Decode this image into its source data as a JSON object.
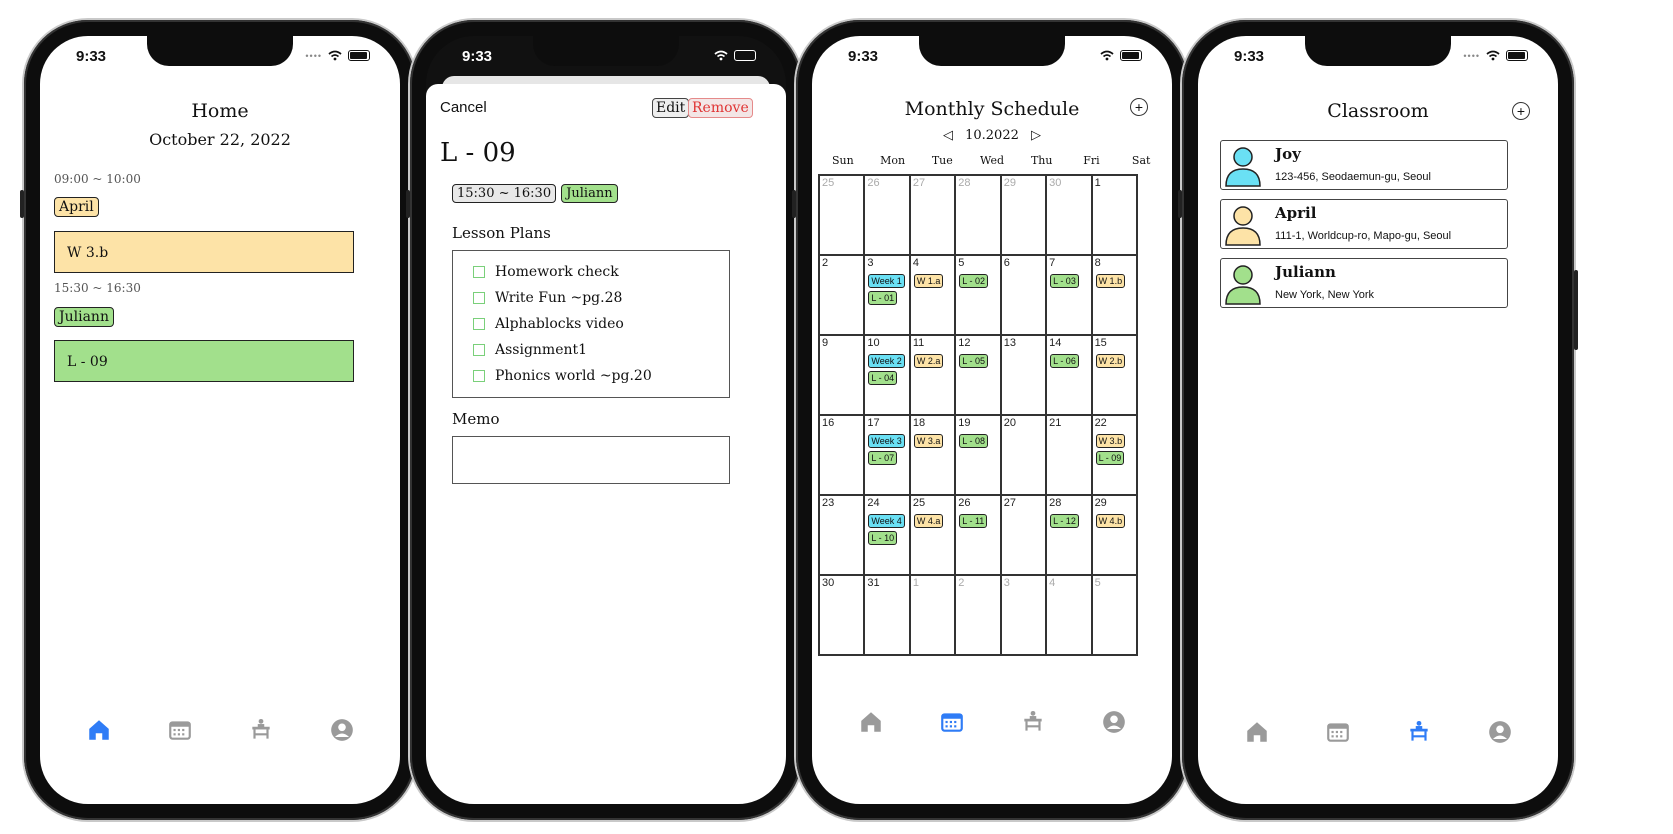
{
  "status": {
    "time": "9:33"
  },
  "colors": {
    "yellow": "#fde3a7",
    "green": "#a2e08c",
    "cyan": "#6ae0f4",
    "active_tab": "#2f7cf6",
    "inactive_tab": "#9a9a9a"
  },
  "tabs": [
    {
      "icon": "home-icon"
    },
    {
      "icon": "calendar-icon"
    },
    {
      "icon": "classroom-desk-icon"
    },
    {
      "icon": "profile-icon"
    }
  ],
  "home": {
    "title": "Home",
    "date": "October 22, 2022",
    "slots": [
      {
        "time": "09:00 ~ 10:00",
        "student": "April",
        "lesson": "W 3.b",
        "color": "yellow"
      },
      {
        "time": "15:30 ~ 16:30",
        "student": "Juliann",
        "lesson": "L - 09",
        "color": "green"
      }
    ]
  },
  "detail": {
    "cancel": "Cancel",
    "edit": "Edit",
    "remove": "Remove",
    "lesson_title": "L - 09",
    "time_tag": "15:30 ~ 16:30",
    "student_tag": "Juliann",
    "lesson_plans_label": "Lesson Plans",
    "plans": [
      "Homework check",
      "Write Fun ~pg.28",
      "Alphablocks video",
      "Assignment1",
      "Phonics world ~pg.20"
    ],
    "memo_label": "Memo",
    "memo_value": ""
  },
  "calendar": {
    "title": "Monthly Schedule",
    "month": "10.2022",
    "weekdays": [
      "Sun",
      "Mon",
      "Tue",
      "Wed",
      "Thu",
      "Fri",
      "Sat"
    ],
    "weeks": [
      [
        {
          "d": "25",
          "dim": true,
          "ev": []
        },
        {
          "d": "26",
          "dim": true,
          "ev": []
        },
        {
          "d": "27",
          "dim": true,
          "ev": []
        },
        {
          "d": "28",
          "dim": true,
          "ev": []
        },
        {
          "d": "29",
          "dim": true,
          "ev": []
        },
        {
          "d": "30",
          "dim": true,
          "ev": []
        },
        {
          "d": "1",
          "ev": []
        }
      ],
      [
        {
          "d": "2",
          "ev": []
        },
        {
          "d": "3",
          "ev": [
            {
              "t": "Week 1",
              "c": "cyan"
            },
            {
              "t": "L - 01",
              "c": "green"
            }
          ]
        },
        {
          "d": "4",
          "ev": [
            {
              "t": "W 1.a",
              "c": "yellow"
            }
          ]
        },
        {
          "d": "5",
          "ev": [
            {
              "t": "L - 02",
              "c": "green"
            }
          ]
        },
        {
          "d": "6",
          "ev": []
        },
        {
          "d": "7",
          "ev": [
            {
              "t": "L - 03",
              "c": "green"
            }
          ]
        },
        {
          "d": "8",
          "ev": [
            {
              "t": "W 1.b",
              "c": "yellow"
            }
          ]
        }
      ],
      [
        {
          "d": "9",
          "ev": []
        },
        {
          "d": "10",
          "ev": [
            {
              "t": "Week 2",
              "c": "cyan"
            },
            {
              "t": "L - 04",
              "c": "green"
            }
          ]
        },
        {
          "d": "11",
          "ev": [
            {
              "t": "W 2.a",
              "c": "yellow"
            }
          ]
        },
        {
          "d": "12",
          "ev": [
            {
              "t": "L - 05",
              "c": "green"
            }
          ]
        },
        {
          "d": "13",
          "ev": []
        },
        {
          "d": "14",
          "ev": [
            {
              "t": "L - 06",
              "c": "green"
            }
          ]
        },
        {
          "d": "15",
          "ev": [
            {
              "t": "W 2.b",
              "c": "yellow"
            }
          ]
        }
      ],
      [
        {
          "d": "16",
          "ev": []
        },
        {
          "d": "17",
          "ev": [
            {
              "t": "Week 3",
              "c": "cyan"
            },
            {
              "t": "L - 07",
              "c": "green"
            }
          ]
        },
        {
          "d": "18",
          "ev": [
            {
              "t": "W 3.a",
              "c": "yellow"
            }
          ]
        },
        {
          "d": "19",
          "ev": [
            {
              "t": "L - 08",
              "c": "green"
            }
          ]
        },
        {
          "d": "20",
          "ev": []
        },
        {
          "d": "21",
          "ev": []
        },
        {
          "d": "22",
          "ev": [
            {
              "t": "W 3.b",
              "c": "yellow"
            },
            {
              "t": "L - 09",
              "c": "green"
            }
          ]
        }
      ],
      [
        {
          "d": "23",
          "ev": []
        },
        {
          "d": "24",
          "ev": [
            {
              "t": "Week 4",
              "c": "cyan"
            },
            {
              "t": "L - 10",
              "c": "green"
            }
          ]
        },
        {
          "d": "25",
          "ev": [
            {
              "t": "W 4.a",
              "c": "yellow"
            }
          ]
        },
        {
          "d": "26",
          "ev": [
            {
              "t": "L - 11",
              "c": "green"
            }
          ]
        },
        {
          "d": "27",
          "ev": []
        },
        {
          "d": "28",
          "ev": [
            {
              "t": "L - 12",
              "c": "green"
            }
          ]
        },
        {
          "d": "29",
          "ev": [
            {
              "t": "W 4.b",
              "c": "yellow"
            }
          ]
        }
      ],
      [
        {
          "d": "30",
          "ev": []
        },
        {
          "d": "31",
          "ev": []
        },
        {
          "d": "1",
          "dim": true,
          "ev": []
        },
        {
          "d": "2",
          "dim": true,
          "ev": []
        },
        {
          "d": "3",
          "dim": true,
          "ev": []
        },
        {
          "d": "4",
          "dim": true,
          "ev": []
        },
        {
          "d": "5",
          "dim": true,
          "ev": []
        }
      ]
    ]
  },
  "classroom": {
    "title": "Classroom",
    "students": [
      {
        "name": "Joy",
        "address": "123-456, Seodaemun-gu, Seoul",
        "color": "cyan"
      },
      {
        "name": "April",
        "address": "111-1, Worldcup-ro, Mapo-gu, Seoul",
        "color": "yellow"
      },
      {
        "name": "Juliann",
        "address": "New York, New York",
        "color": "green"
      }
    ]
  }
}
